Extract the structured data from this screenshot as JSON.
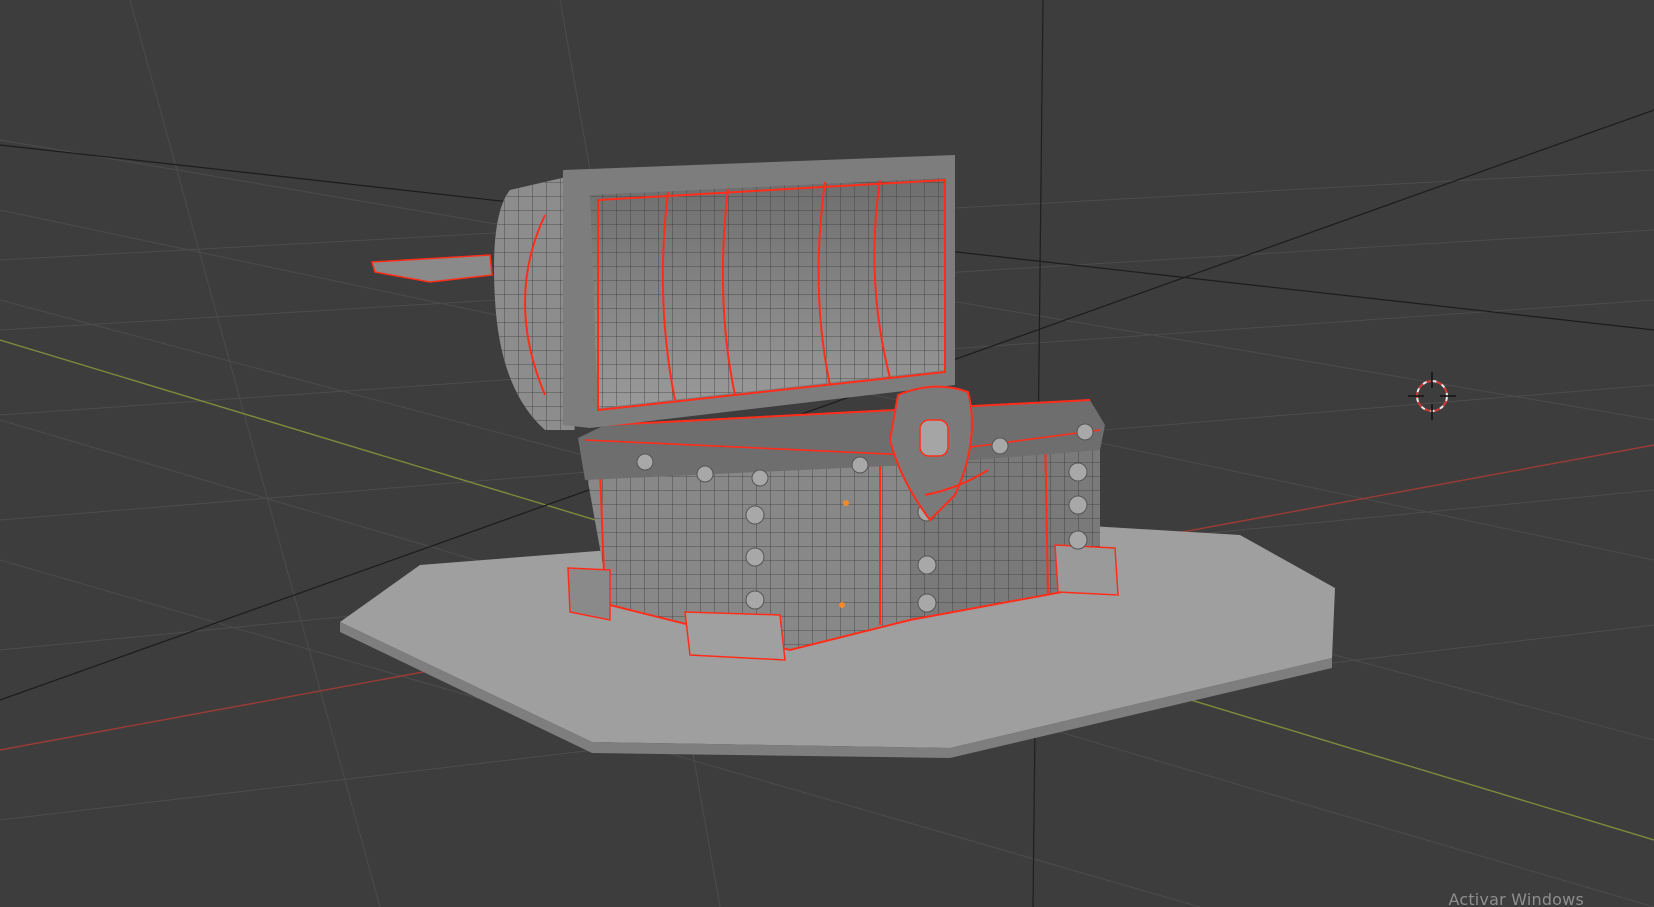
{
  "app": {
    "type": "3D viewport",
    "selected_edge_color": "#ff2d1a",
    "background": "#3d3d3d"
  },
  "viewport": {
    "grid_color": "#4a4a4a",
    "axis_x_color": "#b5443f",
    "axis_y_color": "#8a9a3c",
    "model": "treasure-chest",
    "cursor": "3d-cursor-icon"
  },
  "watermark": {
    "text": "Activar Windows"
  }
}
